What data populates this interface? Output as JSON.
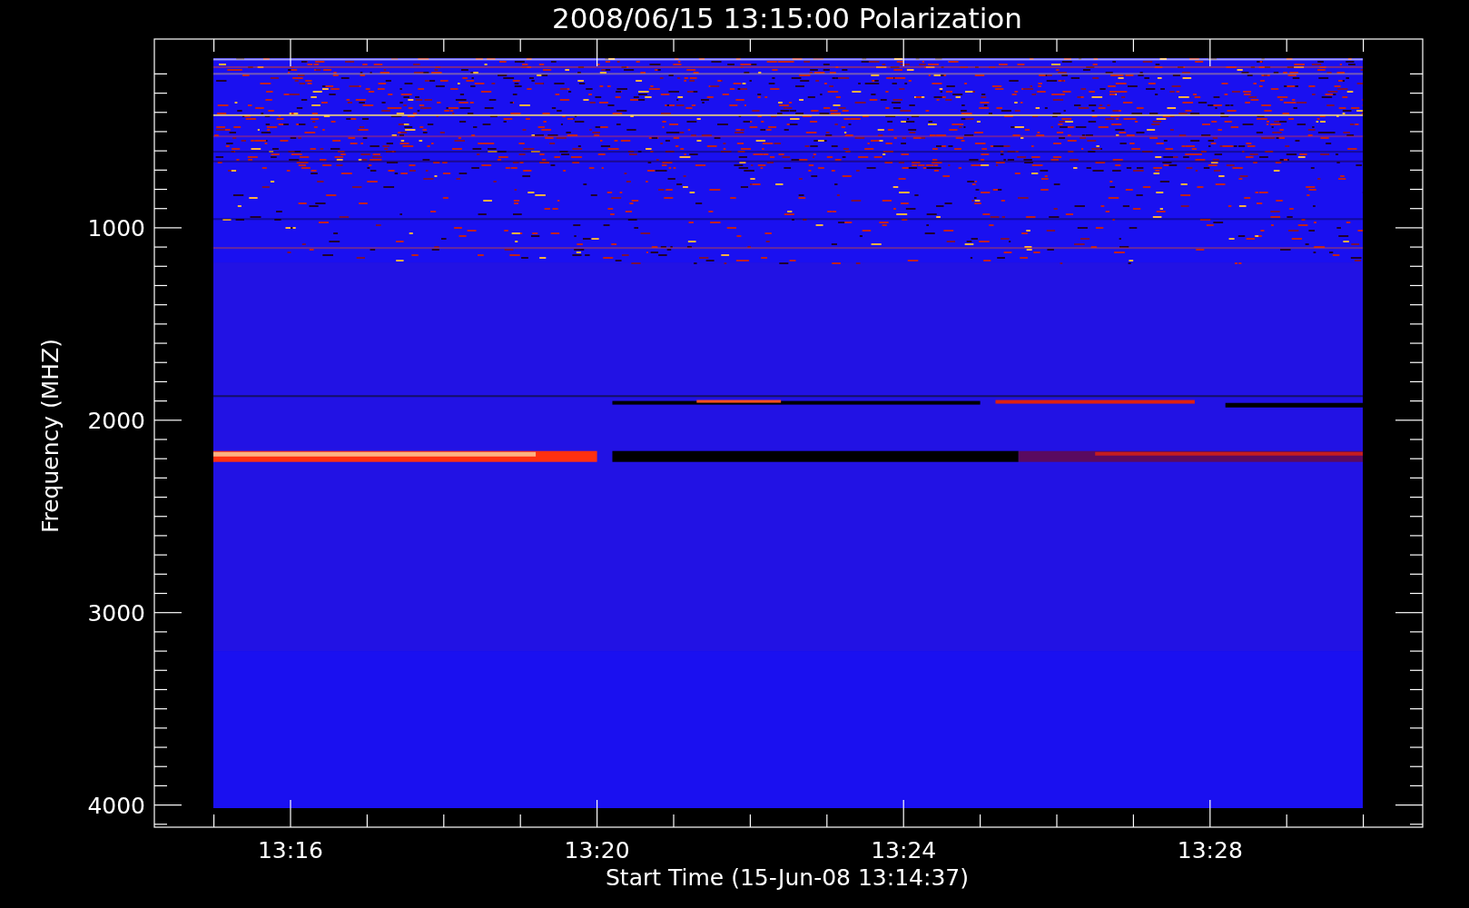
{
  "title": "2008/06/15 13:15:00 Polarization",
  "y_axis": {
    "label": "Frequency (MHZ)",
    "ticks": [
      "1000",
      "2000",
      "3000",
      "4000"
    ]
  },
  "x_axis": {
    "label": "Start Time (15-Jun-08 13:14:37)",
    "ticks": [
      "13:16",
      "13:20",
      "13:24",
      "13:28"
    ]
  }
}
